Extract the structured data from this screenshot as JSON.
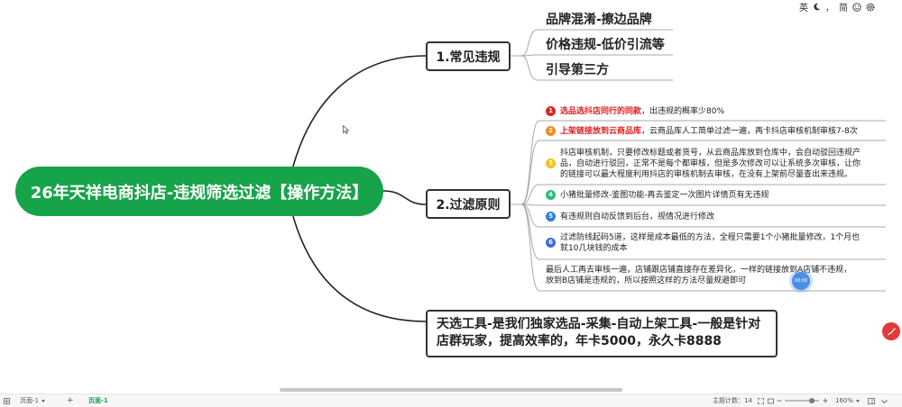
{
  "colors": {
    "root_green": "#17a34a",
    "branch_border": "#333333",
    "connector_main": "#222222",
    "connector_leaf": "#a9a9a9",
    "highlight_red": "#e11d1d",
    "badge_1": "#e02424",
    "badge_2": "#f28a1a",
    "badge_3": "#f4c21b",
    "badge_4": "#2dbf7a",
    "badge_5": "#2f7fe0",
    "badge_6": "#3b6be0",
    "timer_blue": "#4a8ee6",
    "fab_red": "#e53935",
    "tab_green": "#16a34a"
  },
  "ime_toolbar": {
    "language": "英",
    "punctuation": "，",
    "script": "简",
    "icons": [
      "moon-icon",
      "smile-icon",
      "gear-icon"
    ]
  },
  "root": {
    "title": "26年天祥电商抖店-违规筛选过滤【操作方法】"
  },
  "branch1": {
    "label": "1.常见违规",
    "leaves": [
      "品牌混淆-擦边品牌",
      "价格违规-低价引流等",
      "引导第三方"
    ]
  },
  "branch2": {
    "label": "2.过滤原则",
    "leaves": [
      {
        "number": "1",
        "highlight": "选品选抖店同行的同款",
        "text": "，出违规的概率少80%"
      },
      {
        "number": "2",
        "highlight": "上架链接放到云商品库",
        "text": "，云商品库人工简单过滤一遍，再卡抖店审核机制审核7-8次"
      },
      {
        "number": "3",
        "lines": [
          "抖店审核机制，只要修改标题或者货号，从云商品库放到仓库中，会自动驳回违规产",
          "品，自动进行驳回，正常不是每个都审核，但是多次修改可以让系统多次审核，让你",
          "的链接可以最大程度利用抖店的审核机制去审核，在没有上架前尽量查出来违规。"
        ]
      },
      {
        "number": "4",
        "text": "小猪批量修改-鉴图功能-再去鉴定一次图片详情页有无违规"
      },
      {
        "number": "5",
        "text": "有违规则自动反馈到后台，视情况进行修改"
      },
      {
        "number": "6",
        "lines": [
          "过滤防线起码5道，这样是成本最低的方法，全程只需要1个小猪批量修改，1个月也",
          "就10几块钱的成本"
        ]
      },
      {
        "lines": [
          "最后人工再去审核一遍，店铺跟店铺直接存在差异化，一样的链接放到A店铺不违规，",
          "放到B店铺是违规的，所以按照这样的方法尽量规避即可"
        ]
      }
    ]
  },
  "branch3": {
    "lines": [
      "天选工具-是我们独家选品-采集-自动上架工具-一般是针对",
      "店群玩家，提高效率的，年卡5000，永久卡8888"
    ]
  },
  "timer": "00:00",
  "statusbar": {
    "page_selector": "页面-1",
    "add_page": "+",
    "active_tab": "页面-1",
    "topic_count": "主题计数：14",
    "zoom": "160%"
  }
}
